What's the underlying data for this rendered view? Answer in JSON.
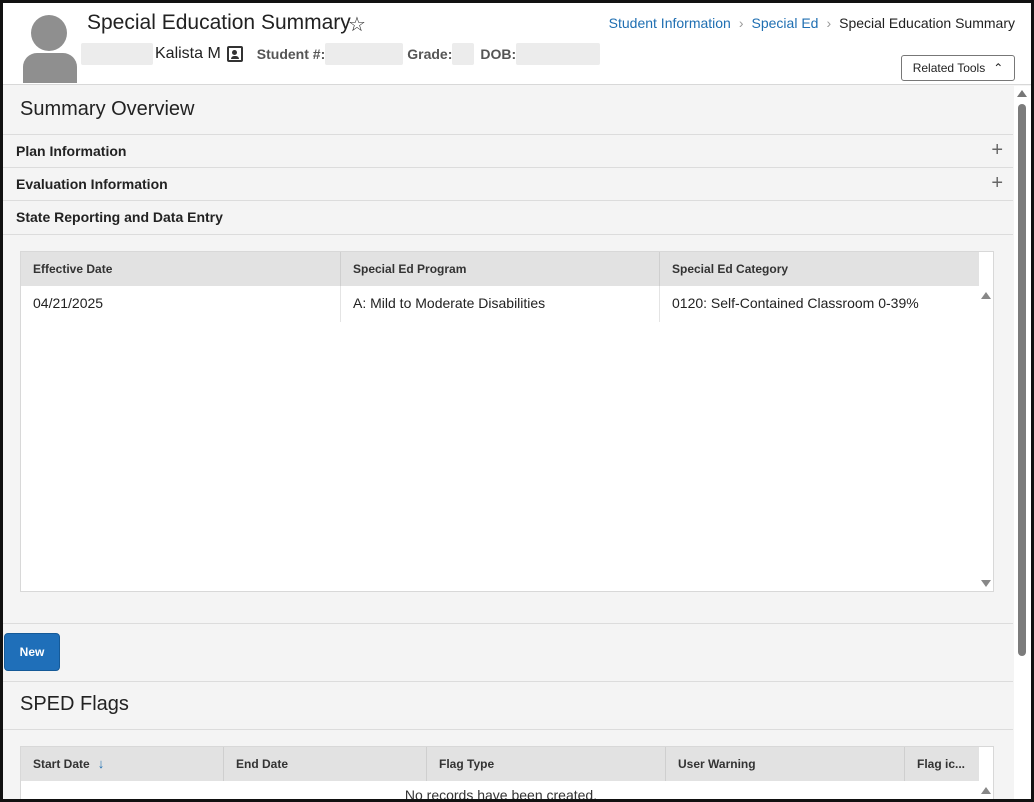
{
  "header": {
    "title": "Special Education Summary",
    "student_name": "Kalista M",
    "student_number_label": "Student #:",
    "grade_label": "Grade:",
    "dob_label": "DOB:",
    "related_tools_label": "Related Tools"
  },
  "breadcrumb": {
    "items": [
      "Student Information",
      "Special Ed",
      "Special Education Summary"
    ]
  },
  "summary": {
    "title": "Summary Overview",
    "sections": [
      {
        "label": "Plan Information",
        "expanded": false
      },
      {
        "label": "Evaluation Information",
        "expanded": false
      },
      {
        "label": "State Reporting and Data Entry",
        "expanded": true
      }
    ],
    "table": {
      "columns": [
        "Effective Date",
        "Special Ed Program",
        "Special Ed Category"
      ],
      "rows": [
        [
          "04/21/2025",
          "A: Mild to Moderate Disabilities",
          "0120: Self-Contained Classroom 0-39%"
        ]
      ]
    },
    "new_button_label": "New"
  },
  "sped_flags": {
    "title": "SPED Flags",
    "columns": [
      "Start Date",
      "End Date",
      "Flag Type",
      "User Warning",
      "Flag ic..."
    ],
    "empty_message": "No records have been created."
  },
  "icons": {
    "star": "star-outline-icon",
    "contact": "contact-card-icon",
    "breadcrumb_sep": "chevron-right-icon",
    "related_tools": "chevron-up-icon",
    "expand": "plus-icon",
    "sort": "arrow-down-icon"
  },
  "colors": {
    "link": "#1f6fb2",
    "primary_button": "#1f6fb9",
    "grid_header": "#e2e2e2"
  }
}
